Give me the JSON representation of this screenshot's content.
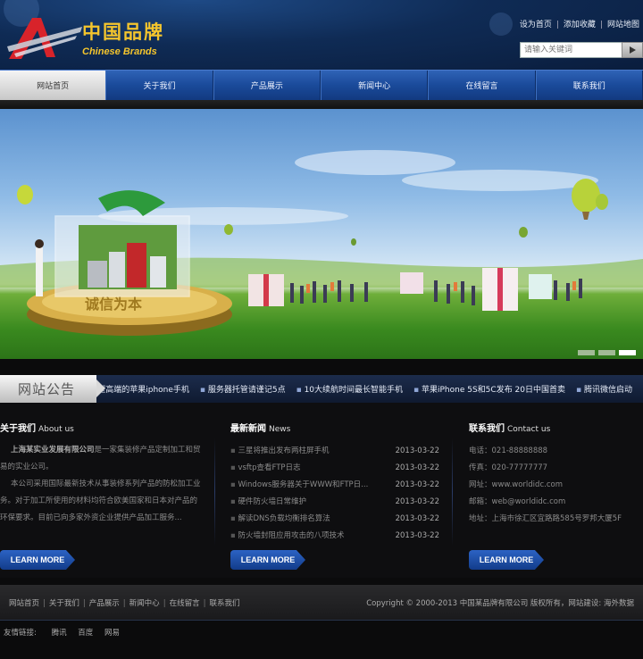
{
  "header": {
    "brand_cn": "中国品牌",
    "brand_en": "Chinese Brands",
    "top_links": [
      "设为首页",
      "添加收藏",
      "网站地图"
    ],
    "search_placeholder": "请输入关键词"
  },
  "nav": {
    "items": [
      "网站首页",
      "关于我们",
      "产品展示",
      "新闻中心",
      "在线留言",
      "联系我们"
    ],
    "active_index": 0
  },
  "banner": {
    "board_text": "诚信为本",
    "slide_count": 3,
    "active_slide": 2
  },
  "notice": {
    "label": "网站公告",
    "items": [
      "电信合作推出首款移动全能型高端的苹果iphone手机",
      "服务器托管请谨记5点",
      "10大续航时间最长智能手机",
      "苹果iPhone 5S和5C发布 20日中国首卖",
      "腾讯微信启动"
    ]
  },
  "about": {
    "title": "关于我们",
    "title_en": "About us",
    "company": "上海某实业发展有限公司",
    "p1_rest": "是一家集装修产品定制加工和贸易的实业公司。",
    "p2": "本公司采用国际最新技术从事装修系列产品的防松加工业务。对于加工所使用的材料均符合欧美国家和日本对产品的环保要求。目前已向多家外资企业提供产品加工服务..."
  },
  "news": {
    "title": "最新新闻",
    "title_en": "News",
    "items": [
      {
        "title": "三星将推出发布两柱屏手机",
        "date": "2013-03-22"
      },
      {
        "title": "vsftp查看FTP日志",
        "date": "2013-03-22"
      },
      {
        "title": "Windows服务器关于WWW和FTP日...",
        "date": "2013-03-22"
      },
      {
        "title": "硬件防火墙日常维护",
        "date": "2013-03-22"
      },
      {
        "title": "解读DNS负载均衡排名算法",
        "date": "2013-03-22"
      },
      {
        "title": "防火墙封阻应用攻击的八项技术",
        "date": "2013-03-22"
      }
    ]
  },
  "contact": {
    "title": "联系我们",
    "title_en": "Contact us",
    "items": [
      "电话：021-88888888",
      "传真：020-77777777",
      "网址：www.worldidc.com",
      "邮箱：web@worldidc.com",
      "地址：上海市徐汇区宜路路585号罗邦大厦5F"
    ]
  },
  "learn_more_label": "LEARN MORE",
  "footer": {
    "nav": [
      "网站首页",
      "关于我们",
      "产品展示",
      "新闻中心",
      "在线留言",
      "联系我们"
    ],
    "copyright": "Copyright © 2000-2013 中国某品牌有限公司 版权所有，网站建设: 海外数据"
  },
  "friend_links": {
    "label": "友情链接:",
    "items": [
      "腾讯",
      "百度",
      "网易"
    ]
  },
  "colors": {
    "brand_gold": "#f4c52d",
    "nav_blue": "#1a4a9a",
    "button_blue": "#2c63c4"
  }
}
